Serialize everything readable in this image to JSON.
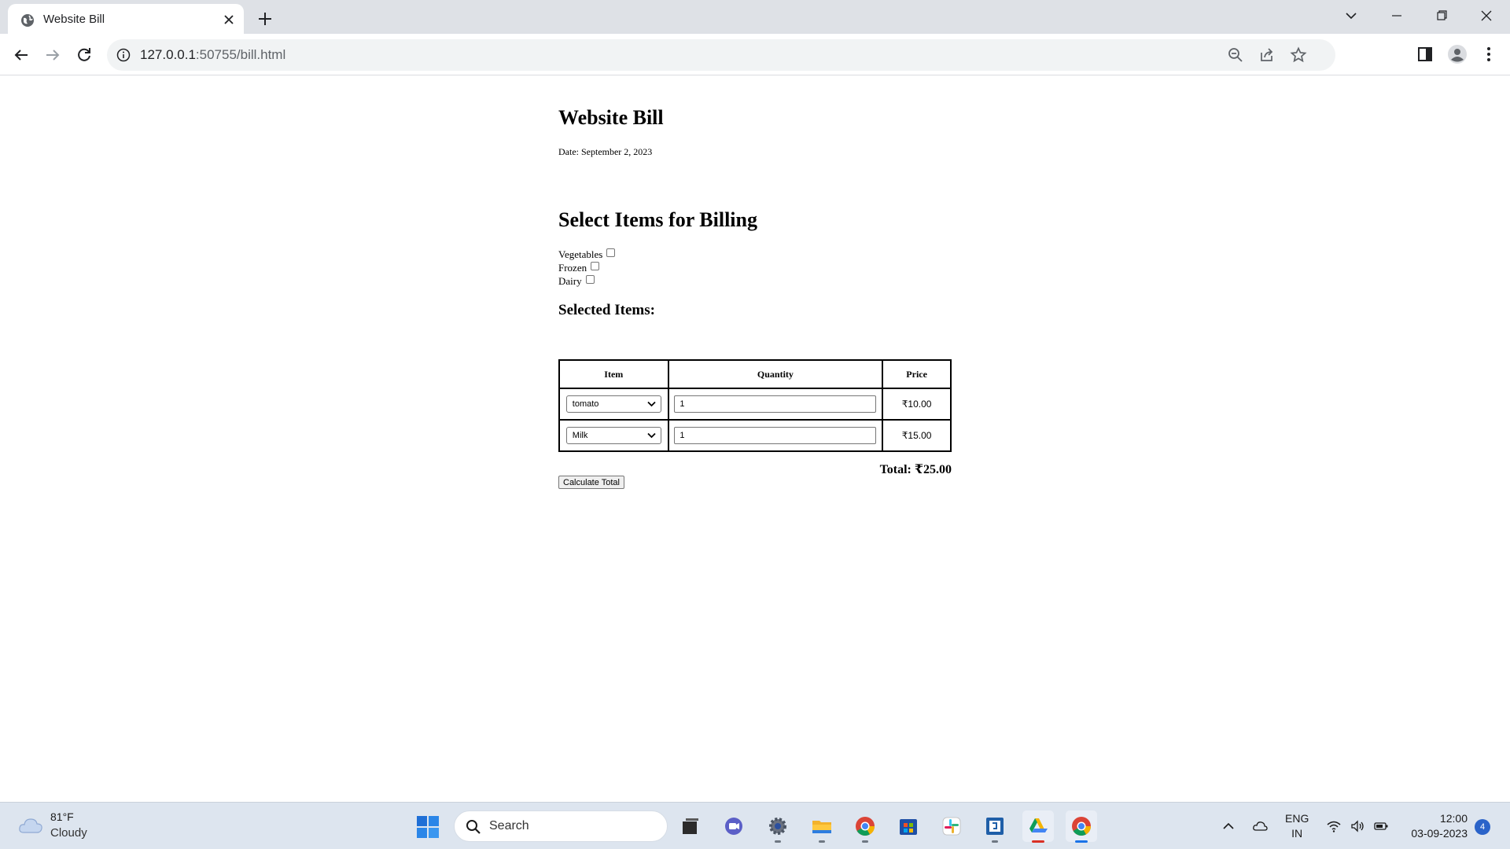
{
  "browser": {
    "tab_title": "Website Bill",
    "url_host": "127.0.0.1",
    "url_rest": ":50755/bill.html"
  },
  "page": {
    "title": "Website Bill",
    "date_line": "Date: September 2, 2023",
    "select_heading": "Select Items for Billing",
    "categories": [
      {
        "label": "Vegetables",
        "checked": false
      },
      {
        "label": "Frozen",
        "checked": false
      },
      {
        "label": "Dairy",
        "checked": false
      }
    ],
    "selected_heading": "Selected Items:",
    "table": {
      "headers": {
        "item": "Item",
        "quantity": "Quantity",
        "price": "Price"
      },
      "rows": [
        {
          "item": "tomato",
          "quantity": "1",
          "price": "₹10.00"
        },
        {
          "item": "Milk",
          "quantity": "1",
          "price": "₹15.00"
        }
      ]
    },
    "total": "Total: ₹25.00",
    "calculate_button": "Calculate Total"
  },
  "taskbar": {
    "weather_temp": "81°F",
    "weather_cond": "Cloudy",
    "search_placeholder": "Search",
    "lang_line1": "ENG",
    "lang_line2": "IN",
    "time": "12:00",
    "date": "03-09-2023",
    "notification_count": "4"
  },
  "colors": {
    "tabstrip": "#dee1e6",
    "taskbar": "#dde5ef",
    "accent_blue": "#1a73e8"
  }
}
